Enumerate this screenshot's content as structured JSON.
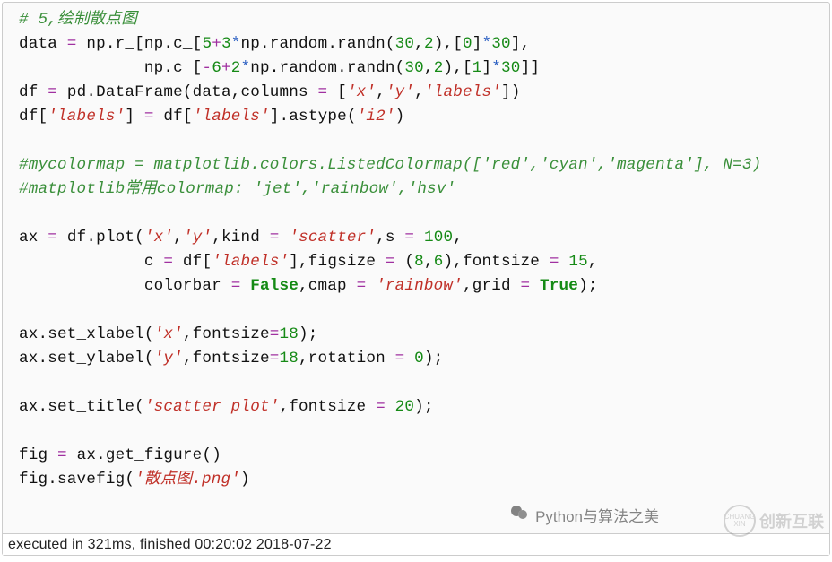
{
  "code": {
    "l1_comment": "# 5,绘制散点图",
    "l2_lhs": "data ",
    "l2_eq": "= ",
    "l2_a": "np.r_[np.c_[",
    "l2_n5": "5",
    "l2_plus": "+",
    "l2_n3": "3",
    "l2_star1": "*",
    "l2_b": "np.random.randn(",
    "l2_n30a": "30",
    "l2_comma1": ",",
    "l2_n2a": "2",
    "l2_c": "),[",
    "l2_n0": "0",
    "l2_d": "]",
    "l2_star2": "*",
    "l2_n30b": "30",
    "l2_e": "],",
    "l3_pad": "             ",
    "l3_a": "np.c_[",
    "l3_minus": "-",
    "l3_n6": "6",
    "l3_plus": "+",
    "l3_n2": "2",
    "l3_star1": "*",
    "l3_b": "np.random.randn(",
    "l3_n30a": "30",
    "l3_comma": ",",
    "l3_n2b": "2",
    "l3_c": "),[",
    "l3_n1": "1",
    "l3_d": "]",
    "l3_star2": "*",
    "l3_n30b": "30",
    "l3_e": "]]",
    "l4_a": "df ",
    "l4_eq": "= ",
    "l4_b": "pd.DataFrame(data,columns ",
    "l4_eq2": "= ",
    "l4_c": "[",
    "l4_s1": "'x'",
    "l4_comma1": ",",
    "l4_s2": "'y'",
    "l4_comma2": ",",
    "l4_s3": "'labels'",
    "l4_d": "])",
    "l5_a": "df[",
    "l5_s1": "'labels'",
    "l5_b": "] ",
    "l5_eq": "= ",
    "l5_c": "df[",
    "l5_s2": "'labels'",
    "l5_d": "].astype(",
    "l5_s3": "'i2'",
    "l5_e": ")",
    "l7_comment": "#mycolormap = matplotlib.colors.ListedColormap(['red','cyan','magenta'], N=3)",
    "l8_comment": "#matplotlib常用colormap: 'jet','rainbow','hsv'",
    "l10_a": "ax ",
    "l10_eq": "= ",
    "l10_b": "df.plot(",
    "l10_s1": "'x'",
    "l10_c": ",",
    "l10_s2": "'y'",
    "l10_d": ",kind ",
    "l10_eq2": "= ",
    "l10_s3": "'scatter'",
    "l10_e": ",s ",
    "l10_eq3": "= ",
    "l10_n100": "100",
    "l10_f": ",",
    "l11_pad": "             ",
    "l11_a": "c ",
    "l11_eq": "= ",
    "l11_b": "df[",
    "l11_s1": "'labels'",
    "l11_c": "],figsize ",
    "l11_eq2": "= ",
    "l11_d": "(",
    "l11_n8": "8",
    "l11_e": ",",
    "l11_n6": "6",
    "l11_f": "),fontsize ",
    "l11_eq3": "= ",
    "l11_n15": "15",
    "l11_g": ",",
    "l12_pad": "             ",
    "l12_a": "colorbar ",
    "l12_eq": "= ",
    "l12_false": "False",
    "l12_b": ",cmap ",
    "l12_eq2": "= ",
    "l12_s1": "'rainbow'",
    "l12_c": ",grid ",
    "l12_eq3": "= ",
    "l12_true": "True",
    "l12_d": ");",
    "l14_a": "ax.set_xlabel(",
    "l14_s1": "'x'",
    "l14_b": ",fontsize",
    "l14_eq": "=",
    "l14_n18": "18",
    "l14_c": ");",
    "l15_a": "ax.set_ylabel(",
    "l15_s1": "'y'",
    "l15_b": ",fontsize",
    "l15_eq": "=",
    "l15_n18": "18",
    "l15_c": ",rotation ",
    "l15_eq2": "= ",
    "l15_n0": "0",
    "l15_d": ");",
    "l17_a": "ax.set_title(",
    "l17_s1": "'scatter plot'",
    "l17_b": ",fontsize ",
    "l17_eq": "= ",
    "l17_n20": "20",
    "l17_c": ");",
    "l19_a": "fig ",
    "l19_eq": "= ",
    "l19_b": "ax.get_figure()",
    "l20_a": "fig.savefig(",
    "l20_s1": "'散点图.png'",
    "l20_b": ")"
  },
  "status": "executed in 321ms, finished 00:20:02 2018-07-22",
  "wechat_label": "Python与算法之美",
  "watermark_text": "创新互联"
}
